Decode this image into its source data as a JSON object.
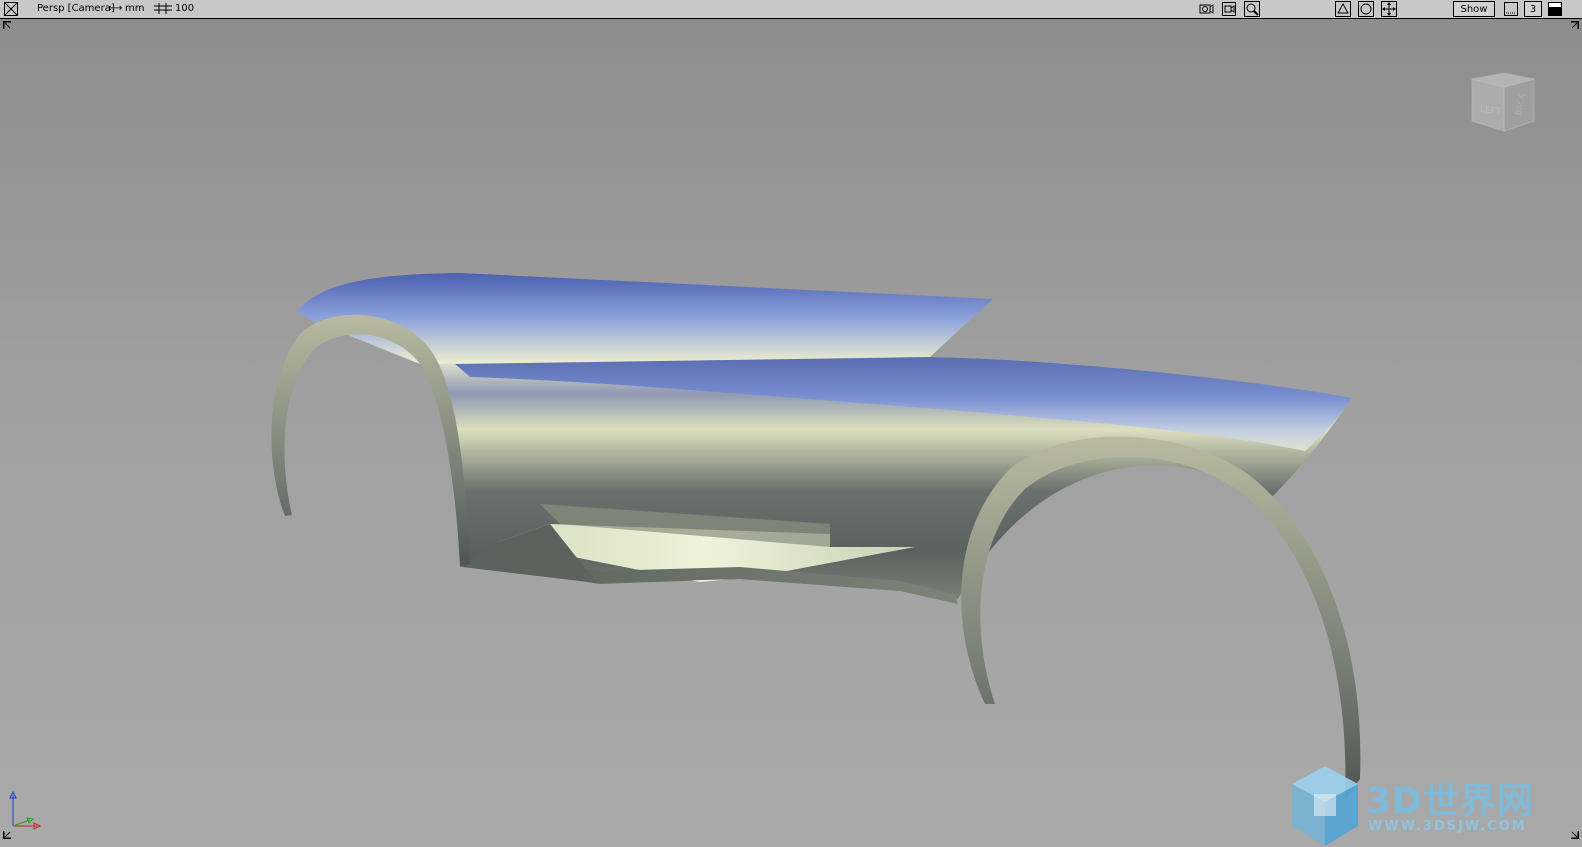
{
  "topbar": {
    "view_label": "Persp [Camera]",
    "units_label": "mm",
    "grid_value": "100",
    "show_label": "Show",
    "num_value": "3",
    "icons": [
      "close-viewport-icon",
      "camera-icon",
      "camera-record-icon",
      "zoom-icon",
      "front-view-icon",
      "frame-icon",
      "pan-move-icon",
      "display-options-icon",
      "maximize-icon"
    ]
  },
  "viewcube": {
    "left_face": "LEFT",
    "back_face": "BACK"
  },
  "watermark": {
    "title": "3D世界网",
    "url": "WWW.3DSJW.COM"
  },
  "axis": {
    "x_color": "#d02020",
    "y_color": "#20a020",
    "z_color": "#2040d0"
  }
}
